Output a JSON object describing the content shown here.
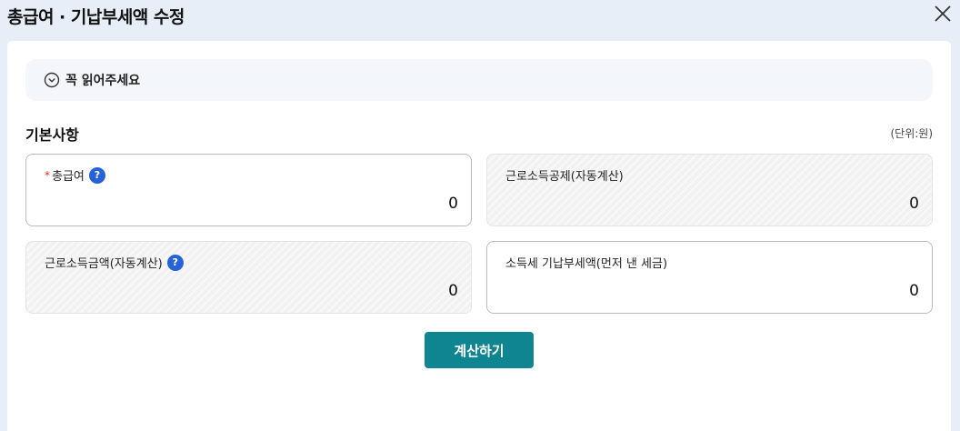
{
  "dialog": {
    "title": "총급여 · 기납부세액 수정",
    "close_icon": "close-icon"
  },
  "notice": {
    "icon": "chevron-down-circle-icon",
    "label": "꼭 읽어주세요"
  },
  "section": {
    "title": "기본사항",
    "unit": "(단위:원)"
  },
  "fields": {
    "total_salary": {
      "required_mark": "*",
      "label": "총급여",
      "help": "?",
      "value": "0"
    },
    "earned_income_deduction": {
      "label": "근로소득공제(자동계산)",
      "value": "0"
    },
    "earned_income_amount": {
      "label": "근로소득금액(자동계산)",
      "help": "?",
      "value": "0"
    },
    "prepaid_income_tax": {
      "label": "소득세 기납부세액(먼저 낸 세금)",
      "value": "0"
    }
  },
  "buttons": {
    "calculate": "계산하기"
  },
  "colors": {
    "accent_button": "#0f8591",
    "help_icon": "#2563d6",
    "required_mark": "#e02b2b",
    "background": "#e8eef7"
  }
}
